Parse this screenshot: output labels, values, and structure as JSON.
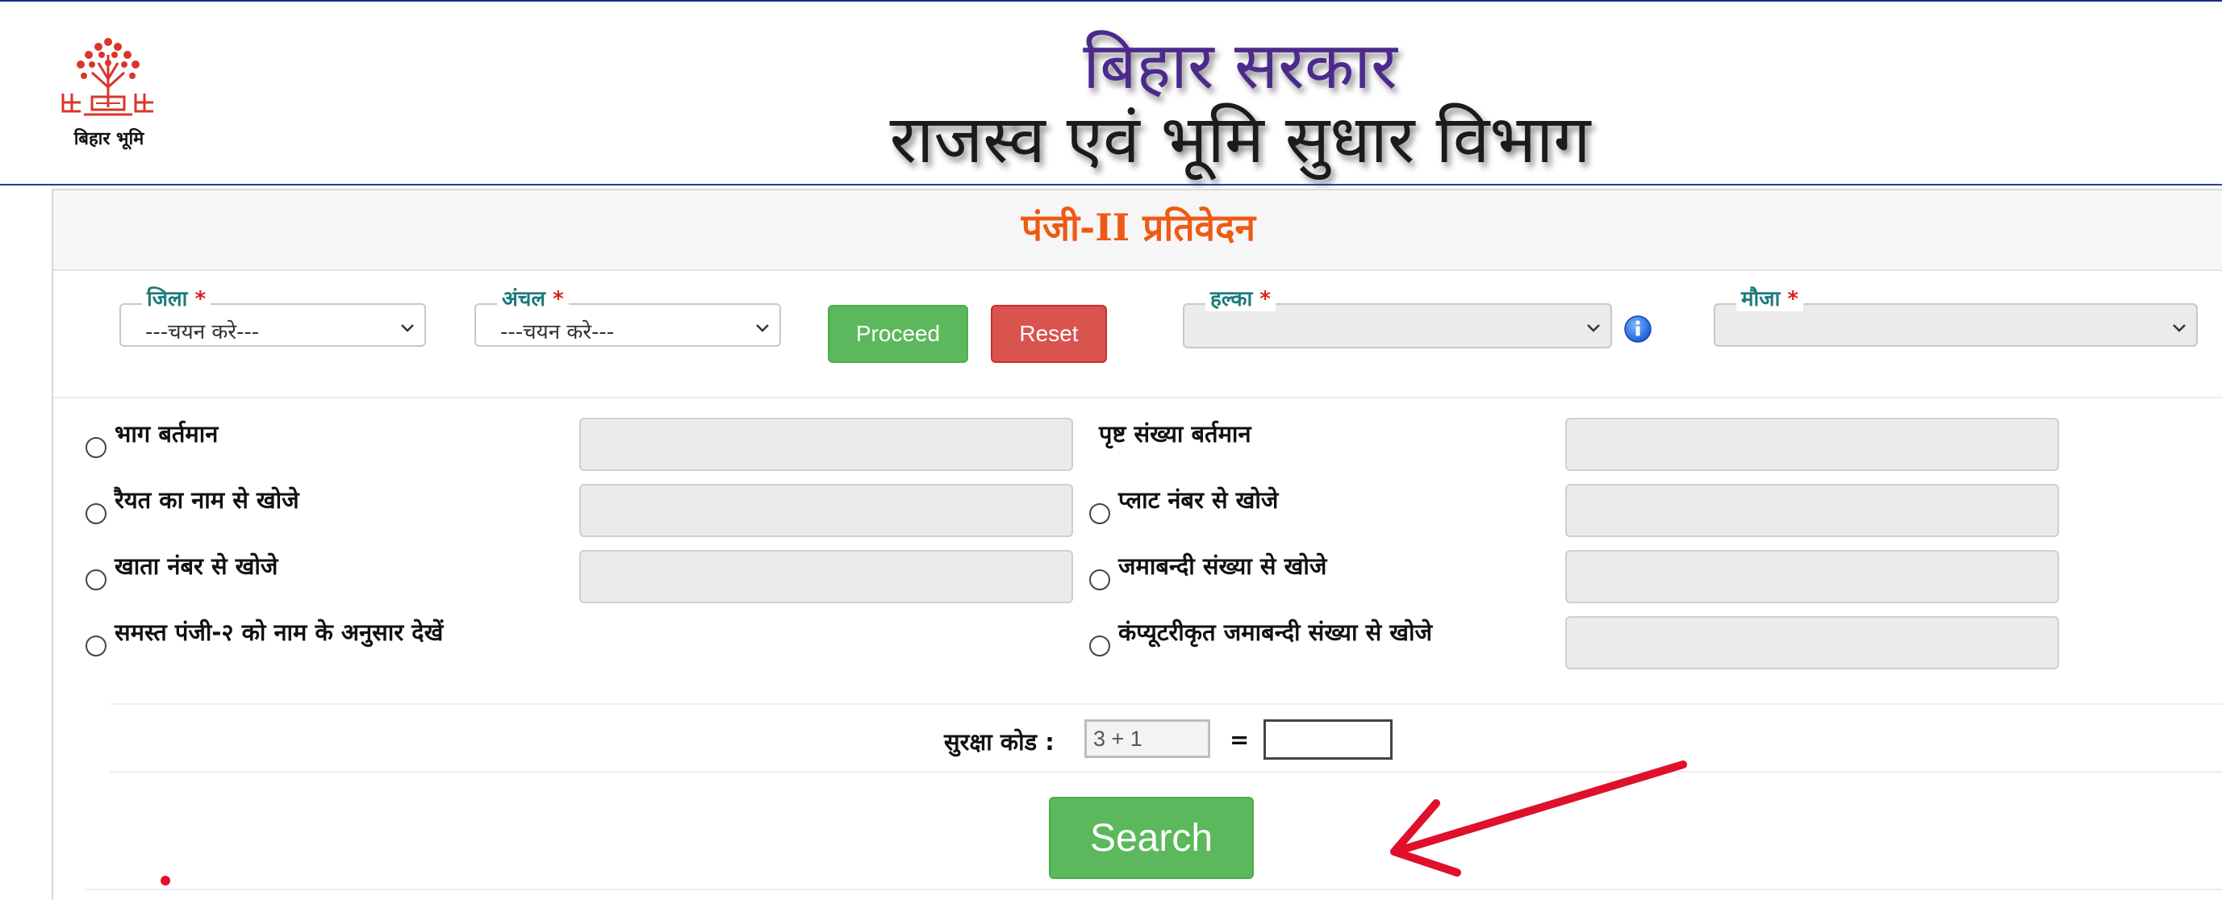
{
  "header": {
    "logo_caption": "बिहार भूमि",
    "title_line1": "बिहार सरकार",
    "title_line2": "राजस्व एवं भूमि सुधार विभाग"
  },
  "panel": {
    "title": "पंजी-II प्रतिवेदन"
  },
  "filters": {
    "district": {
      "label": "जिला",
      "required": "*",
      "value": "---चयन करे---"
    },
    "circle": {
      "label": "अंचल",
      "required": "*",
      "value": "---चयन करे---"
    },
    "proceed_label": "Proceed",
    "reset_label": "Reset",
    "halka": {
      "label": "हल्का",
      "required": "*",
      "value": ""
    },
    "mauja": {
      "label": "मौजा",
      "required": "*",
      "value": ""
    }
  },
  "search_options": {
    "part_current": "भाग बर्तमान",
    "page_count_current": "पृष्ट संख्या बर्तमान",
    "raiyat_name": "रैयत का नाम से खोजे",
    "plot_number": "प्लाट नंबर से खोजे",
    "khata_number": "खाता नंबर से खोजे",
    "jamabandi_number": "जमाबन्दी संख्या से खोजे",
    "all_panji_by_name": "समस्त पंजी-२ को नाम के अनुसार देखें",
    "computerized_jamabandi": "कंप्यूटरीकृत जमाबन्दी संख्या से खोजे"
  },
  "captcha": {
    "label": "सुरक्षा कोड :",
    "code": "3 + 1",
    "equals": "="
  },
  "search_label": "Search",
  "colors": {
    "title_purple": "#4b2a8c",
    "panel_title_orange": "#ee5a14",
    "legend_teal": "#1c7a7a",
    "proceed_green": "#5cb85c",
    "reset_red": "#d9534f",
    "annotation_red": "#e0102a"
  }
}
